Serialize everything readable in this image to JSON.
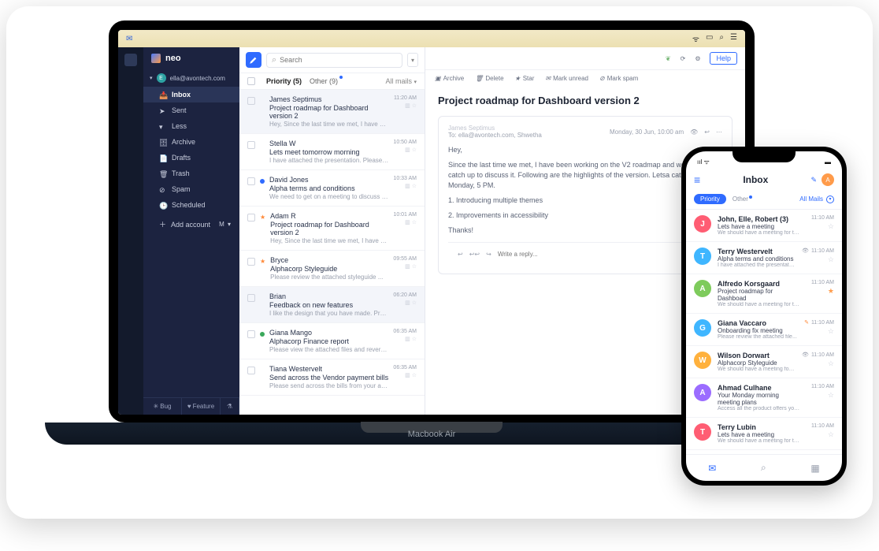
{
  "device_label": "Macbook Air",
  "brand": "neo",
  "account_email": "ella@avontech.com",
  "account_initial": "E",
  "folders": [
    {
      "label": "Inbox",
      "active": true
    },
    {
      "label": "Sent"
    },
    {
      "label": "Less"
    },
    {
      "label": "Archive"
    },
    {
      "label": "Drafts"
    },
    {
      "label": "Trash"
    },
    {
      "label": "Spam"
    },
    {
      "label": "Scheduled"
    }
  ],
  "add_account": "Add account",
  "side_footer": {
    "bug": "Bug",
    "feature": "Feature"
  },
  "search": {
    "placeholder": "Search"
  },
  "tabs": {
    "priority": "Priority (5)",
    "other": "Other (9)",
    "filter": "All mails"
  },
  "toolbar": {
    "help": "Help"
  },
  "actions": {
    "archive": "Archive",
    "delete": "Delete",
    "star": "Star",
    "mark_unread": "Mark unread",
    "mark_spam": "Mark spam"
  },
  "mails": [
    {
      "sender": "James Septimus",
      "subject": "Project roadmap for Dashboard version 2",
      "preview": "Hey, Since the last time we met, I have been...",
      "time": "11:20 AM",
      "selected": true
    },
    {
      "sender": "Stella W",
      "subject": "Lets meet tomorrow morning",
      "preview": "I have attached the presentation. Please check and l...",
      "time": "10:50 AM"
    },
    {
      "sender": "David Jones",
      "subject": "Alpha terms and conditions",
      "preview": "We need to get on a meeting to discuss the updated ter...",
      "time": "10:33 AM",
      "dot": "#2f6bff"
    },
    {
      "sender": "Adam R",
      "subject": "Project roadmap for Dashboard version 2",
      "preview": "Hey, Since the last time we met, I have been wor...",
      "time": "10:01 AM",
      "star": "#ff8a3a"
    },
    {
      "sender": "Bryce",
      "subject": "Alphacorp Styleguide",
      "preview": "Please review the attached styleguide ...",
      "time": "09:55 AM",
      "star": "#ff8a3a"
    },
    {
      "sender": "Brian",
      "subject": "Feedback on new features",
      "preview": "I like the design that you have made. Probably...",
      "time": "06:20 AM",
      "highlighted": true
    },
    {
      "sender": "Giana Mango",
      "subject": "Alphacorp Finance report",
      "preview": "Please view the attached files and revert on the...",
      "time": "06:35 AM",
      "dot": "#3aa85a"
    },
    {
      "sender": "Tiana Westervelt",
      "subject": "Send across the Vendor payment bills",
      "preview": "Please send across the bills from your account ...",
      "time": "06:35 AM"
    }
  ],
  "reader": {
    "subject": "Project roadmap for Dashboard version 2",
    "from_name": "James Septimus",
    "to": "To: ella@avontech.com, Shwetha",
    "date": "Monday, 30 Jun, 10:00 am",
    "greeting": "Hey,",
    "p1": "Since the last time we met, I have been working on the V2 roadmap and wold like to catch up to discuss it. Following are the highlights of the version. Letsa catch up on Monday, 5 PM.",
    "l1": "1. Introducing multiple themes",
    "l2": "2. Improvements in accessibility",
    "thanks": "Thanks!",
    "reply_placeholder": "Write a reply..."
  },
  "phone": {
    "inbox_title": "Inbox",
    "avatar_initial": "A",
    "tab_priority": "Priority",
    "tab_other": "Other",
    "filter": "All Mails",
    "items": [
      {
        "initial": "J",
        "color": "#ff5d73",
        "sender": "John, Elle, Robert (3)",
        "subject": "Lets have a meeting",
        "preview": "We should have a meeting for the up...",
        "time": "11:10 AM"
      },
      {
        "initial": "T",
        "color": "#3fb6ff",
        "sender": "Terry Westervelt",
        "subject": "Alpha terms and conditions",
        "preview": "I have attached the presentation...",
        "time": "11:10 AM",
        "eye": true
      },
      {
        "initial": "A",
        "color": "#7ecb5c",
        "sender": "Alfredo Korsgaard",
        "subject": "Project roadmap for Dashboad",
        "preview": "We should have a meeting for the up...",
        "time": "11:10 AM",
        "starred": true
      },
      {
        "initial": "G",
        "color": "#3fb6ff",
        "sender": "Giana Vaccaro",
        "subject": "Onboarding fix meeting",
        "preview": "Please review the attached file...",
        "time": "11:10 AM",
        "pencil": true
      },
      {
        "initial": "W",
        "color": "#ffb13d",
        "sender": "Wilson Dorwart",
        "subject": "Alphacorp Styleguide",
        "preview": "We should have a meeting for the up...",
        "time": "11:10 AM",
        "eye": true
      },
      {
        "initial": "A",
        "color": "#9b6cff",
        "sender": "Ahmad Culhane",
        "subject": "Your Monday morning meeting plans",
        "preview": "Access all the product offers you ...",
        "time": "11:10 AM"
      },
      {
        "initial": "T",
        "color": "#ff5d73",
        "sender": "Terry Lubin",
        "subject": "Lets have a meeting",
        "preview": "We should have a meeting for the up...",
        "time": "11:10 AM"
      }
    ]
  }
}
